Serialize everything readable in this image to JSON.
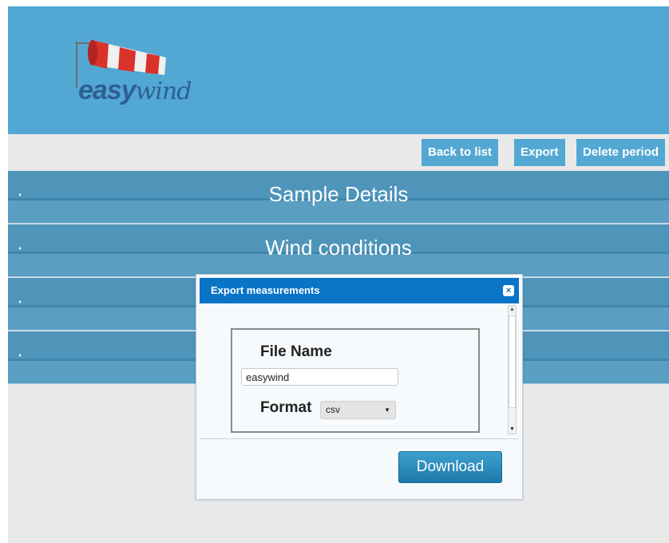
{
  "header": {
    "logo_text_1": "easy",
    "logo_text_2": "wind"
  },
  "toolbar": {
    "back_label": "Back to list",
    "export_label": "Export",
    "delete_label": "Delete period"
  },
  "sections": [
    {
      "title": "Sample Details"
    },
    {
      "title": "Wind conditions"
    },
    {
      "title": ""
    },
    {
      "title": ""
    }
  ],
  "dialog": {
    "title": "Export measurements",
    "close_glyph": "×",
    "file_name_label": "File Name",
    "file_name_value": "easywind",
    "format_label": "Format",
    "format_value": "csv",
    "download_label": "Download"
  },
  "colors": {
    "header_bg": "#53a8d3",
    "section_bg": "#4f95ba",
    "dialog_title_bg": "#0a74c7",
    "button_bg": "#53a8d3"
  }
}
